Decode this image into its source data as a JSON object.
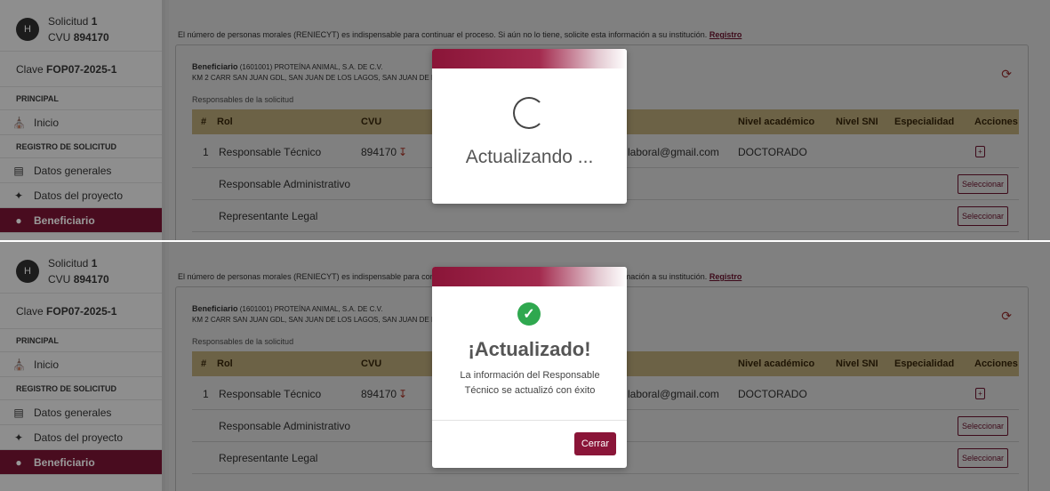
{
  "sidebar": {
    "avatar_initial": "H",
    "solicitud_prefix": "Solicitud",
    "solicitud_number": "1",
    "cvu_prefix": "CVU",
    "cvu_value": "894170",
    "clave_prefix": "Clave",
    "clave_value": "FOP07-2025-1",
    "section_principal": "PRINCIPAL",
    "item_inicio": "Inicio",
    "section_registro": "REGISTRO DE SOLICITUD",
    "item_datos_generales": "Datos generales",
    "item_datos_proyecto": "Datos del proyecto",
    "item_beneficiario": "Beneficiario"
  },
  "main": {
    "notice": "El número de personas morales (RENIECYT) es indispensable para continuar el proceso. Si aún no lo tiene, solicite esta información a su institución.",
    "notice_link": "Registro",
    "beneficiario_label": "Beneficiario",
    "beneficiario_name": "(1601001) PROTEÍNA ANIMAL, S.A. DE C.V.",
    "beneficiario_address": "KM 2 CARR SAN JUAN GDL, SAN JUAN DE LOS LAGOS, SAN JUAN DE LOS",
    "responsables_label": "Responsables de la solicitud",
    "columns": {
      "num": "#",
      "rol": "Rol",
      "cvu": "CVU",
      "nivel_academico": "Nivel académico",
      "nivel_sni": "Nivel SNI",
      "especialidad": "Especialidad",
      "acciones": "Acciones"
    },
    "rows": [
      {
        "num": "1",
        "rol": "Responsable Técnico",
        "cvu": "894170",
        "email": "laboral@gmail.com",
        "nivel": "DOCTORADO"
      },
      {
        "rol": "Responsable Administrativo",
        "action": "Seleccionar"
      },
      {
        "rol": "Representante Legal",
        "action": "Seleccionar"
      }
    ]
  },
  "modal_loading": {
    "text": "Actualizando ..."
  },
  "modal_success": {
    "title": "¡Actualizado!",
    "message": "La información del Responsable Técnico se actualizó con éxito",
    "close_label": "Cerrar"
  },
  "colors": {
    "brand": "#7a1433",
    "table_header": "#d8c48b",
    "success": "#2fa84f"
  }
}
